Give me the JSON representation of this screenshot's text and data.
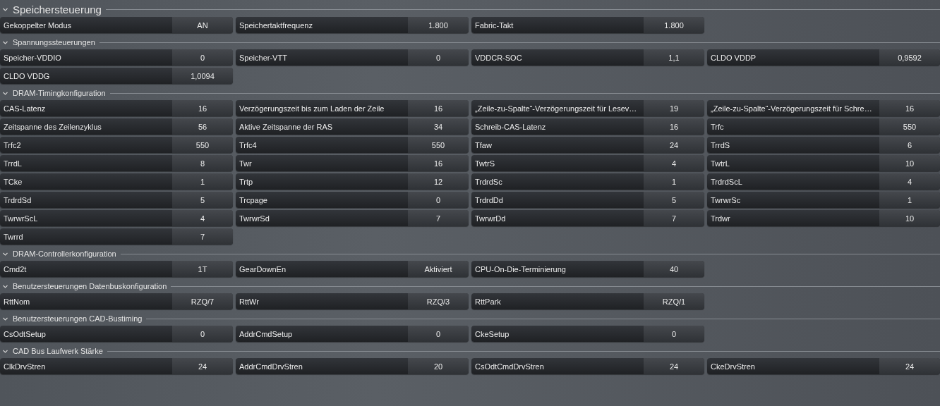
{
  "sections": [
    {
      "title": "Speichersteuerung",
      "expanded": true,
      "rows": [
        {
          "label": "Gekoppelter Modus",
          "value": "AN"
        },
        {
          "label": "Speichertaktfrequenz",
          "value": "1.800"
        },
        {
          "label": "Fabric-Takt",
          "value": "1.800"
        }
      ]
    },
    {
      "title": "Spannungssteuerungen",
      "expanded": true,
      "rows": [
        {
          "label": "Speicher-VDDIO",
          "value": "0"
        },
        {
          "label": "Speicher-VTT",
          "value": "0"
        },
        {
          "label": "VDDCR-SOC",
          "value": "1,1"
        },
        {
          "label": "CLDO VDDP",
          "value": "0,9592"
        },
        {
          "label": "CLDO VDDG",
          "value": "1,0094"
        }
      ]
    },
    {
      "title": "DRAM-Timingkonfiguration",
      "expanded": true,
      "rows": [
        {
          "label": "CAS-Latenz",
          "value": "16"
        },
        {
          "label": "Verzögerungszeit bis zum Laden der Zeile",
          "value": "16"
        },
        {
          "label": "„Zeile-zu-Spalte“-Verzögerungszeit für Lesev…",
          "value": "19"
        },
        {
          "label": "„Zeile-zu-Spalte“-Verzögerungszeit für Schre…",
          "value": "16"
        },
        {
          "label": "Zeitspanne des Zeilenzyklus",
          "value": "56"
        },
        {
          "label": "Aktive Zeitspanne der RAS",
          "value": "34"
        },
        {
          "label": "Schreib-CAS-Latenz",
          "value": "16"
        },
        {
          "label": "Trfc",
          "value": "550"
        },
        {
          "label": "Trfc2",
          "value": "550"
        },
        {
          "label": "Trfc4",
          "value": "550"
        },
        {
          "label": "Tfaw",
          "value": "24"
        },
        {
          "label": "TrrdS",
          "value": "6"
        },
        {
          "label": "TrrdL",
          "value": "8"
        },
        {
          "label": "Twr",
          "value": "16"
        },
        {
          "label": "TwtrS",
          "value": "4"
        },
        {
          "label": "TwtrL",
          "value": "10"
        },
        {
          "label": "TCke",
          "value": "1"
        },
        {
          "label": "Trtp",
          "value": "12"
        },
        {
          "label": "TrdrdSc",
          "value": "1"
        },
        {
          "label": "TrdrdScL",
          "value": "4"
        },
        {
          "label": "TrdrdSd",
          "value": "5"
        },
        {
          "label": "Trcpage",
          "value": "0"
        },
        {
          "label": "TrdrdDd",
          "value": "5"
        },
        {
          "label": "TwrwrSc",
          "value": "1"
        },
        {
          "label": "TwrwrScL",
          "value": "4"
        },
        {
          "label": "TwrwrSd",
          "value": "7"
        },
        {
          "label": "TwrwrDd",
          "value": "7"
        },
        {
          "label": "Trdwr",
          "value": "10"
        },
        {
          "label": "Twrrd",
          "value": "7"
        }
      ]
    },
    {
      "title": "DRAM-Controllerkonfiguration",
      "expanded": true,
      "rows": [
        {
          "label": "Cmd2t",
          "value": "1T"
        },
        {
          "label": "GearDownEn",
          "value": "Aktiviert"
        },
        {
          "label": "CPU-On-Die-Terminierung",
          "value": "40"
        }
      ]
    },
    {
      "title": "Benutzersteuerungen Datenbuskonfiguration",
      "expanded": true,
      "rows": [
        {
          "label": "RttNom",
          "value": "RZQ/7"
        },
        {
          "label": "RttWr",
          "value": "RZQ/3"
        },
        {
          "label": "RttPark",
          "value": "RZQ/1"
        }
      ]
    },
    {
      "title": "Benutzersteuerungen CAD-Bustiming",
      "expanded": true,
      "rows": [
        {
          "label": "CsOdtSetup",
          "value": "0"
        },
        {
          "label": "AddrCmdSetup",
          "value": "0"
        },
        {
          "label": "CkeSetup",
          "value": "0"
        }
      ]
    },
    {
      "title": "CAD Bus Laufwerk Stärke",
      "expanded": true,
      "rows": [
        {
          "label": "ClkDrvStren",
          "value": "24"
        },
        {
          "label": "AddrCmdDrvStren",
          "value": "20"
        },
        {
          "label": "CsOdtCmdDrvStren",
          "value": "24"
        },
        {
          "label": "CkeDrvStren",
          "value": "24"
        }
      ]
    }
  ]
}
